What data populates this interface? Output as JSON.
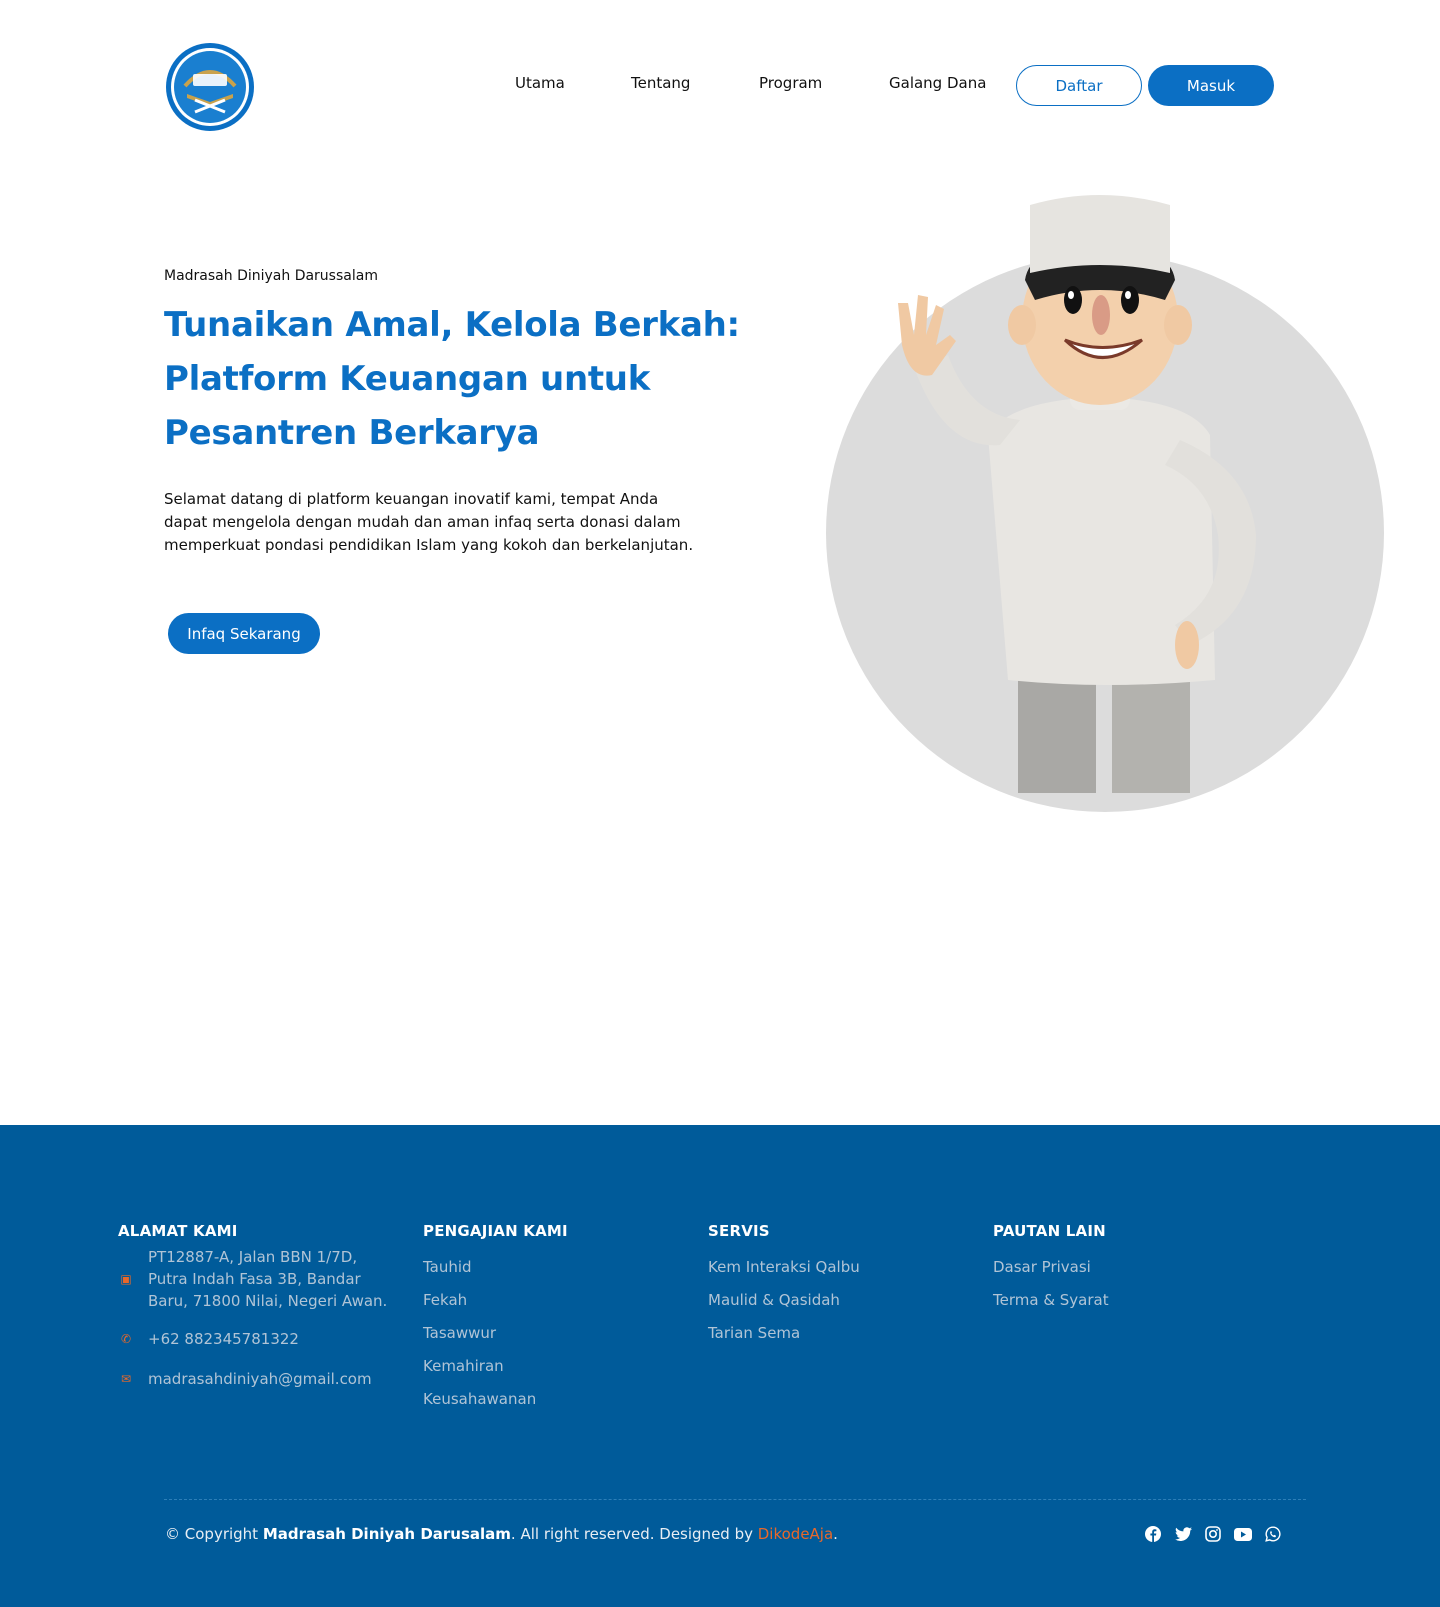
{
  "colors": {
    "primary": "#0b6fc4",
    "footer_bg": "#005b9a",
    "accent": "#e8682a",
    "muted_link": "#b0c4d6"
  },
  "header": {
    "logo_icon": "madrasah-crest-logo",
    "nav": [
      {
        "label": "Utama"
      },
      {
        "label": "Tentang"
      },
      {
        "label": "Program"
      },
      {
        "label": "Galang Dana"
      }
    ],
    "register_label": "Daftar",
    "login_label": "Masuk"
  },
  "hero": {
    "eyebrow": "Madrasah Diniyah Darussalam",
    "headline": "Tunaikan Amal, Kelola Berkah: Platform Keuangan untuk Pesantren Berkarya",
    "intro": "Selamat datang di platform keuangan inovatif kami, tempat Anda dapat mengelola dengan mudah dan aman infaq serta donasi dalam memperkuat pondasi pendidikan Islam yang kokoh dan berkelanjutan.",
    "cta_label": "Infaq Sekarang",
    "illustration": "waving-character-illustration"
  },
  "footer": {
    "address": {
      "title": "ALAMAT KAMI",
      "street": "PT12887-A, Jalan BBN 1/7D, Putra Indah Fasa 3B, Bandar Baru, 71800 Nilai, Negeri Awan.",
      "phone": "+62 882345781322",
      "email": "madrasahdiniyah@gmail.com"
    },
    "studies": {
      "title": "PENGAJIAN KAMI",
      "items": [
        "Tauhid",
        "Fekah",
        "Tasawwur",
        "Kemahiran",
        "Keusahawanan"
      ]
    },
    "services": {
      "title": "SERVIS",
      "items": [
        "Kem Interaksi Qalbu",
        "Maulid & Qasidah",
        "Tarian Sema"
      ]
    },
    "links": {
      "title": "PAUTAN LAIN",
      "items": [
        "Dasar Privasi",
        "Terma & Syarat"
      ]
    },
    "copyright": {
      "prefix": "© Copyright ",
      "org": "Madrasah Diniyah Darusalam",
      "middle": ". All right reserved. Designed by ",
      "designer": "DikodeAja",
      "suffix": "."
    },
    "socials": [
      "facebook-icon",
      "twitter-icon",
      "instagram-icon",
      "youtube-icon",
      "whatsapp-icon"
    ]
  }
}
